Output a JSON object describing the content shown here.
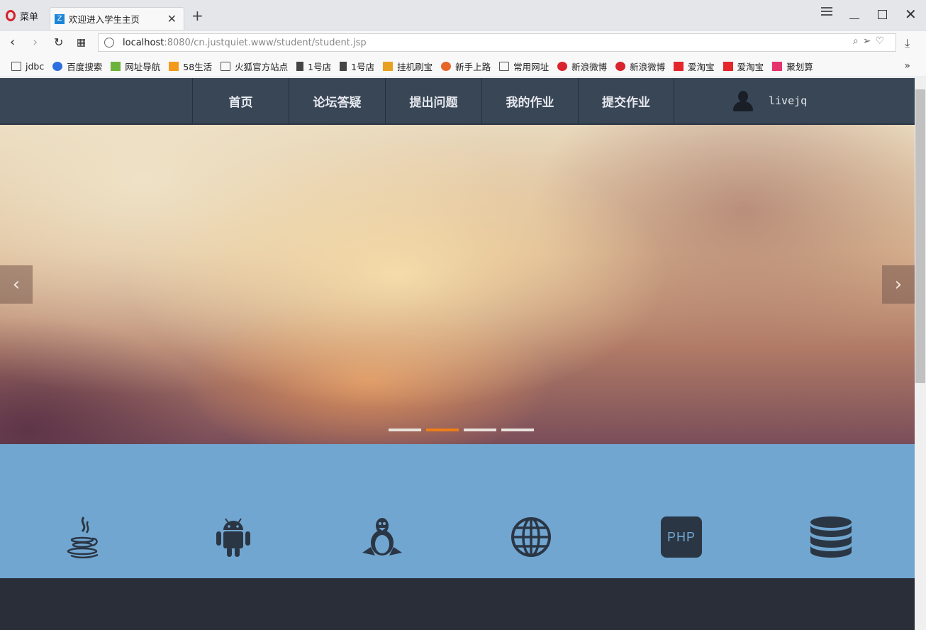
{
  "browser": {
    "menu_label": "菜单",
    "tab": {
      "title": "欢迎进入学生主页",
      "favicon_letter": "Z"
    },
    "url": {
      "host": "localhost",
      "rest": ":8080/cn.justquiet.www/student/student.jsp"
    },
    "bookmarks": [
      {
        "label": "jdbc",
        "icon": "folder-icon"
      },
      {
        "label": "百度搜索",
        "icon": "baidu-icon"
      },
      {
        "label": "网址导航",
        "icon": "hao-icon"
      },
      {
        "label": "58生活",
        "icon": "58-icon"
      },
      {
        "label": "火狐官方站点",
        "icon": "folder-icon"
      },
      {
        "label": "1号店",
        "icon": "document-icon"
      },
      {
        "label": "1号店",
        "icon": "document-icon"
      },
      {
        "label": "挂机刷宝",
        "icon": "pma-icon"
      },
      {
        "label": "新手上路",
        "icon": "firefox-icon"
      },
      {
        "label": "常用网址",
        "icon": "folder-icon"
      },
      {
        "label": "新浪微博",
        "icon": "weibo-icon"
      },
      {
        "label": "新浪微博",
        "icon": "weibo-icon"
      },
      {
        "label": "爱淘宝",
        "icon": "taobao-icon"
      },
      {
        "label": "爱淘宝",
        "icon": "taobao-icon"
      },
      {
        "label": "聚划算",
        "icon": "juhuasuan-icon"
      }
    ]
  },
  "site": {
    "nav": [
      "首页",
      "论坛答疑",
      "提出问题",
      "我的作业",
      "提交作业"
    ],
    "username": "livejq",
    "slider": {
      "slide_count": 4,
      "active_index": 1
    },
    "tech_icons": [
      "java-icon",
      "android-icon",
      "linux-icon",
      "web-icon",
      "php-icon",
      "database-icon"
    ],
    "tech_php_text": "PHP",
    "active_tech_index": 0,
    "colors": {
      "nav_bg": "#394656",
      "band_bg": "#71a6d1",
      "icon_color": "#2b3644",
      "active_dot": "#f07e16",
      "active_bar": "#0f8a1f"
    }
  }
}
